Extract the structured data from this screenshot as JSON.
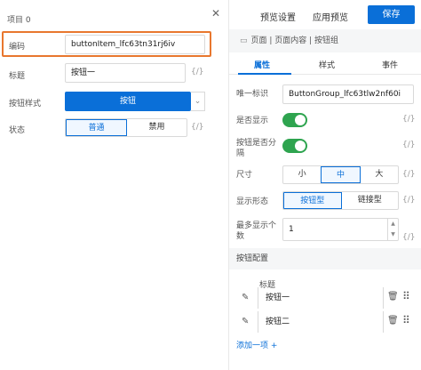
{
  "left_panel": {
    "title": "项目 0",
    "fields": {
      "code": {
        "label": "编码",
        "value": "buttonItem_lfc63tn31rj6iv"
      },
      "title": {
        "label": "标题",
        "value": "按钮一",
        "suffix": "{/}"
      },
      "style": {
        "label": "按钮样式",
        "value": "按钮"
      },
      "state": {
        "label": "状态",
        "options": [
          "普通",
          "禁用"
        ],
        "selected": "普通",
        "suffix": "{/}"
      }
    }
  },
  "right_panel": {
    "top": {
      "preview_settings": "预览设置",
      "app_preview": "应用预览",
      "save": "保存"
    },
    "breadcrumb": "页面 | 页面内容 | 按钮组",
    "tabs": [
      "属性",
      "样式",
      "事件"
    ],
    "active_tab": "属性",
    "props": {
      "uid": {
        "label": "唯一标识",
        "value": "ButtonGroup_lfc63tlw2nf60i"
      },
      "visible": {
        "label": "是否显示",
        "on": true,
        "suffix": "{/}"
      },
      "split": {
        "label": "按钮是否分隔",
        "on": true,
        "suffix": "{/}"
      },
      "size": {
        "label": "尺寸",
        "options": [
          "小",
          "中",
          "大"
        ],
        "selected": "中",
        "suffix": "{/}"
      },
      "display": {
        "label": "显示形态",
        "options": [
          "按钮型",
          "链接型"
        ],
        "selected": "按钮型",
        "suffix": "{/}"
      },
      "max": {
        "label": "最多显示个数",
        "value": "1",
        "suffix": "{/}"
      }
    },
    "config": {
      "section_title": "按钮配置",
      "column_title": "标题",
      "rows": [
        "按钮一",
        "按钮二"
      ],
      "add_label": "添加一项 +"
    }
  },
  "colors": {
    "primary": "#0a6fd8",
    "highlight": "#e8772e",
    "toggle_on": "#2ea44f"
  }
}
